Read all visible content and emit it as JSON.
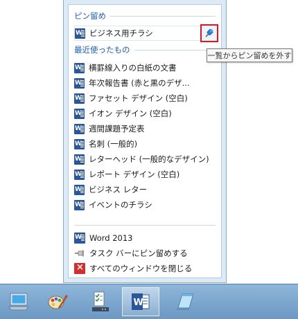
{
  "jumplist": {
    "pinned_header": "ピン留め",
    "pinned_items": [
      {
        "label": "ビジネス用チラシ"
      }
    ],
    "recent_header": "最近使ったもの",
    "recent_items": [
      {
        "label": "横罫線入りの白紙の文書"
      },
      {
        "label": "年次報告書 (赤と黒のデザ..."
      },
      {
        "label": "ファセット デザイン (空白)"
      },
      {
        "label": "イオン デザイン (空白)"
      },
      {
        "label": "週間課題予定表"
      },
      {
        "label": "名刺 (一般的)"
      },
      {
        "label": "レターヘッド (一般的なデザイン)"
      },
      {
        "label": "レポート デザイン (空白)"
      },
      {
        "label": "ビジネス レター"
      },
      {
        "label": "イベントのチラシ"
      }
    ],
    "tasks": [
      {
        "label": "Word 2013",
        "icon": "word-icon"
      },
      {
        "label": "タスク バーにピン留めする",
        "icon": "pin-icon"
      },
      {
        "label": "すべてのウィンドウを閉じる",
        "icon": "close-window-icon"
      }
    ]
  },
  "tooltip": "一覧からピン留めを外す",
  "taskbar": {
    "items": [
      {
        "icon": "computer-icon"
      },
      {
        "icon": "paint-icon"
      },
      {
        "icon": "task-manager-icon"
      },
      {
        "icon": "word-icon",
        "active": true
      },
      {
        "icon": "notepad-icon"
      }
    ]
  },
  "colors": {
    "header_text": "#1c5fb0",
    "word_blue": "#2b579a",
    "highlight_red": "#e8131f",
    "taskbar": "#7aa5cf"
  }
}
